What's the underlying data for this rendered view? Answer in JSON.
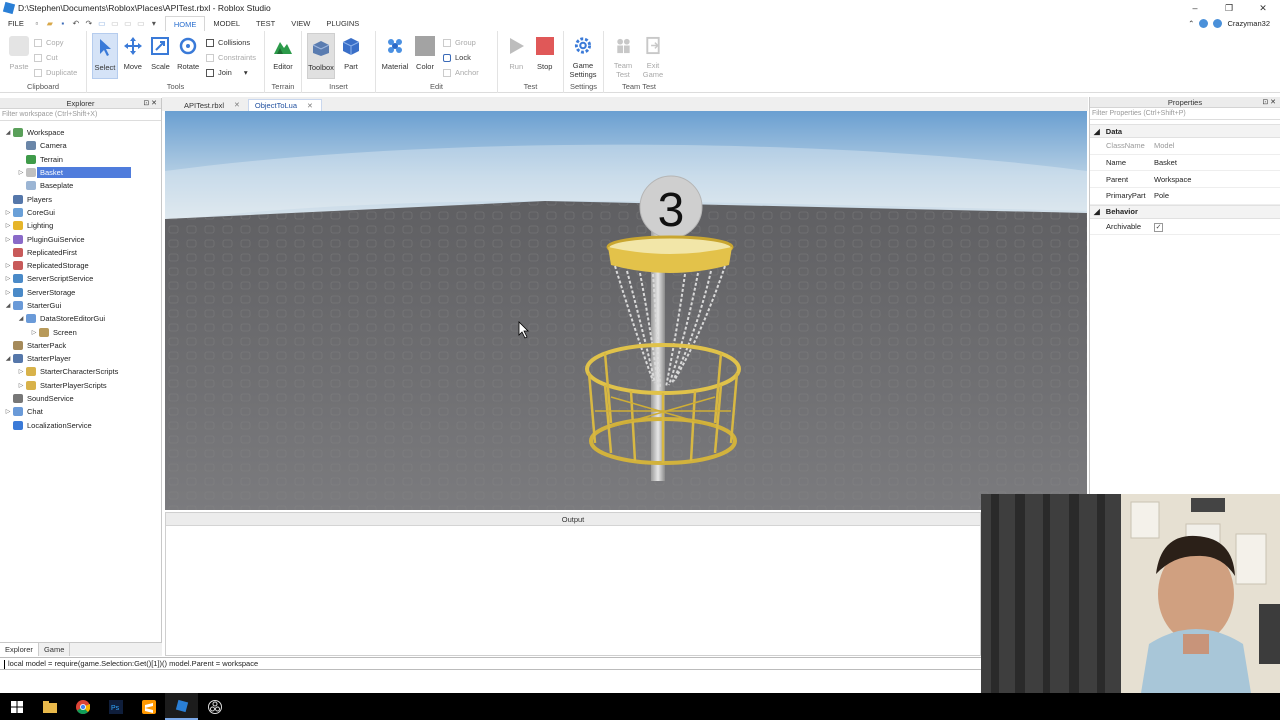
{
  "window": {
    "title": "D:\\Stephen\\Documents\\Roblox\\Places\\APITest.rbxl - Roblox Studio",
    "minimize": "–",
    "maximize": "❐",
    "close": "✕"
  },
  "menu": {
    "file": "FILE",
    "tabs": [
      {
        "label": "HOME",
        "active": true
      },
      {
        "label": "MODEL"
      },
      {
        "label": "TEST"
      },
      {
        "label": "VIEW"
      },
      {
        "label": "PLUGINS"
      }
    ],
    "user": "Crazyman32"
  },
  "ribbon": {
    "clipboard": {
      "label": "Clipboard",
      "paste": "Paste",
      "copy": "Copy",
      "cut": "Cut",
      "duplicate": "Duplicate"
    },
    "tools": {
      "label": "Tools",
      "select": "Select",
      "move": "Move",
      "scale": "Scale",
      "rotate": "Rotate",
      "collisions": "Collisions",
      "constraints": "Constraints",
      "join": "Join"
    },
    "terrain": {
      "label": "Terrain",
      "editor": "Editor"
    },
    "insert": {
      "label": "Insert",
      "toolbox": "Toolbox",
      "part": "Part"
    },
    "edit": {
      "label": "Edit",
      "material": "Material",
      "color": "Color",
      "group": "Group",
      "lock": "Lock",
      "anchor": "Anchor"
    },
    "test": {
      "label": "Test",
      "run": "Run",
      "stop": "Stop"
    },
    "settings": {
      "label": "Settings",
      "game_settings_1": "Game",
      "game_settings_2": "Settings"
    },
    "team_test": {
      "label": "Team Test",
      "team_1": "Team",
      "team_2": "Test",
      "exit_1": "Exit",
      "exit_2": "Game"
    }
  },
  "explorer": {
    "title": "Explorer",
    "filter_placeholder": "Filter workspace (Ctrl+Shift+X)",
    "nodes": [
      {
        "label": "Workspace",
        "depth": 0,
        "expand": "◢",
        "icon_color": "#5aa05a"
      },
      {
        "label": "Camera",
        "depth": 1,
        "expand": "",
        "icon_color": "#6a86a8"
      },
      {
        "label": "Terrain",
        "depth": 1,
        "expand": "",
        "icon_color": "#3f9b4a"
      },
      {
        "label": "Basket",
        "depth": 1,
        "expand": "▷",
        "icon_color": "#c0c0c0",
        "selected": true
      },
      {
        "label": "Baseplate",
        "depth": 1,
        "expand": "",
        "icon_color": "#9bb5d4"
      },
      {
        "label": "Players",
        "depth": 0,
        "expand": "",
        "icon_color": "#5577aa"
      },
      {
        "label": "CoreGui",
        "depth": 0,
        "expand": "▷",
        "icon_color": "#6aa0d8"
      },
      {
        "label": "Lighting",
        "depth": 0,
        "expand": "▷",
        "icon_color": "#e6b52a"
      },
      {
        "label": "PluginGuiService",
        "depth": 0,
        "expand": "▷",
        "icon_color": "#8a6ac8"
      },
      {
        "label": "ReplicatedFirst",
        "depth": 0,
        "expand": "",
        "icon_color": "#c85a5a"
      },
      {
        "label": "ReplicatedStorage",
        "depth": 0,
        "expand": "▷",
        "icon_color": "#c85a5a"
      },
      {
        "label": "ServerScriptService",
        "depth": 0,
        "expand": "▷",
        "icon_color": "#4a8ac8"
      },
      {
        "label": "ServerStorage",
        "depth": 0,
        "expand": "▷",
        "icon_color": "#4a8ac8"
      },
      {
        "label": "StarterGui",
        "depth": 0,
        "expand": "◢",
        "icon_color": "#6a9ad8"
      },
      {
        "label": "DataStoreEditorGui",
        "depth": 1,
        "expand": "◢",
        "icon_color": "#6a9ad8"
      },
      {
        "label": "Screen",
        "depth": 2,
        "expand": "▷",
        "icon_color": "#b89a5a"
      },
      {
        "label": "StarterPack",
        "depth": 0,
        "expand": "",
        "icon_color": "#a58a5a"
      },
      {
        "label": "StarterPlayer",
        "depth": 0,
        "expand": "◢",
        "icon_color": "#5577aa"
      },
      {
        "label": "StarterCharacterScripts",
        "depth": 1,
        "expand": "▷",
        "icon_color": "#d8b24a"
      },
      {
        "label": "StarterPlayerScripts",
        "depth": 1,
        "expand": "▷",
        "icon_color": "#d8b24a"
      },
      {
        "label": "SoundService",
        "depth": 0,
        "expand": "",
        "icon_color": "#777777"
      },
      {
        "label": "Chat",
        "depth": 0,
        "expand": "▷",
        "icon_color": "#6a9ad8"
      },
      {
        "label": "LocalizationService",
        "depth": 0,
        "expand": "",
        "icon_color": "#3a7ad8"
      }
    ],
    "bottom_tabs": [
      {
        "label": "Explorer",
        "active": true
      },
      {
        "label": "Game"
      }
    ]
  },
  "doc_tabs": [
    {
      "label": "APITest.rbxl",
      "active": false
    },
    {
      "label": "ObjectToLua",
      "active": true
    }
  ],
  "viewport": {
    "hole_number": "3"
  },
  "output": {
    "title": "Output"
  },
  "properties": {
    "title": "Properties",
    "filter_placeholder": "Filter Properties (Ctrl+Shift+P)",
    "sections": [
      {
        "name": "Data",
        "rows": [
          {
            "key": "ClassName",
            "value": "Model",
            "readonly": true
          },
          {
            "key": "Name",
            "value": "Basket"
          },
          {
            "key": "Parent",
            "value": "Workspace"
          },
          {
            "key": "PrimaryPart",
            "value": "Pole"
          }
        ]
      },
      {
        "name": "Behavior",
        "rows": [
          {
            "key": "Archivable",
            "value": "✓",
            "checkbox": true
          }
        ]
      }
    ]
  },
  "command_bar": {
    "text": "local model = require(game.Selection:Get()[1])() model.Parent = workspace"
  }
}
